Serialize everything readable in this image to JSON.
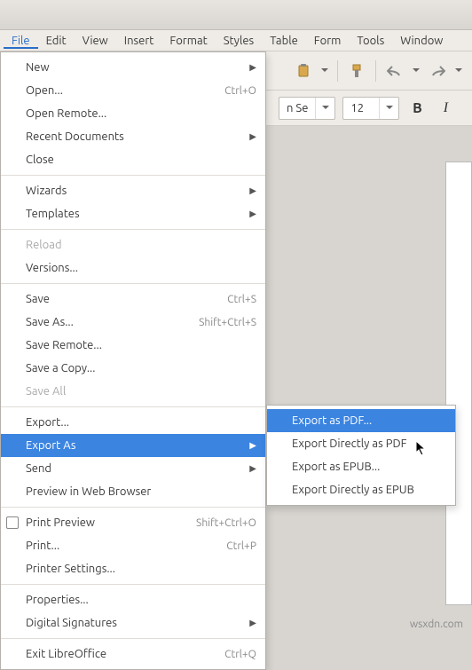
{
  "menubar": {
    "items": [
      {
        "label": "File",
        "active": true
      },
      {
        "label": "Edit"
      },
      {
        "label": "View"
      },
      {
        "label": "Insert"
      },
      {
        "label": "Format"
      },
      {
        "label": "Styles"
      },
      {
        "label": "Table"
      },
      {
        "label": "Form"
      },
      {
        "label": "Tools"
      },
      {
        "label": "Window"
      }
    ]
  },
  "format_toolbar": {
    "font_name_visible": "n Se",
    "font_size": "12"
  },
  "file_menu": {
    "items": [
      {
        "label": "New",
        "submenu": true
      },
      {
        "label": "Open...",
        "shortcut": "Ctrl+O"
      },
      {
        "label": "Open Remote..."
      },
      {
        "label": "Recent Documents",
        "submenu": true
      },
      {
        "label": "Close"
      },
      {
        "divider": true
      },
      {
        "label": "Wizards",
        "submenu": true
      },
      {
        "label": "Templates",
        "submenu": true
      },
      {
        "divider": true
      },
      {
        "label": "Reload",
        "disabled": true
      },
      {
        "label": "Versions..."
      },
      {
        "divider": true
      },
      {
        "label": "Save",
        "shortcut": "Ctrl+S"
      },
      {
        "label": "Save As...",
        "shortcut": "Shift+Ctrl+S"
      },
      {
        "label": "Save Remote..."
      },
      {
        "label": "Save a Copy..."
      },
      {
        "label": "Save All",
        "disabled": true
      },
      {
        "divider": true
      },
      {
        "label": "Export..."
      },
      {
        "label": "Export As",
        "submenu": true,
        "highlight": true
      },
      {
        "label": "Send",
        "submenu": true
      },
      {
        "label": "Preview in Web Browser"
      },
      {
        "divider": true
      },
      {
        "label": "Print Preview",
        "shortcut": "Shift+Ctrl+O",
        "checkbox": true
      },
      {
        "label": "Print...",
        "shortcut": "Ctrl+P"
      },
      {
        "label": "Printer Settings..."
      },
      {
        "divider": true
      },
      {
        "label": "Properties..."
      },
      {
        "label": "Digital Signatures",
        "submenu": true
      },
      {
        "divider": true
      },
      {
        "label": "Exit LibreOffice",
        "shortcut": "Ctrl+Q"
      }
    ]
  },
  "export_submenu": {
    "items": [
      {
        "label": "Export as PDF...",
        "highlight": true
      },
      {
        "label": "Export Directly as PDF"
      },
      {
        "label": "Export as EPUB..."
      },
      {
        "label": "Export Directly as EPUB"
      }
    ]
  },
  "watermark": "wsxdn.com"
}
